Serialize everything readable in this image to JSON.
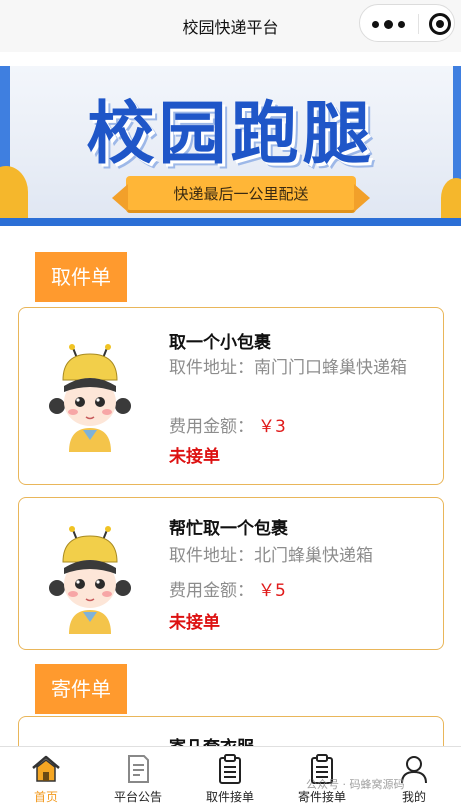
{
  "navbar": {
    "title": "校园快递平台",
    "capsule_icons": [
      "more-dots-icon",
      "close-target-icon"
    ]
  },
  "banner": {
    "title": "校园跑腿",
    "subtitle": "快递最后一公里配送"
  },
  "sections": {
    "pickup_title": "取件单",
    "send_title": "寄件单"
  },
  "pickup_orders": [
    {
      "title": "取一个小包裹",
      "address_label": "取件地址：",
      "address": "南门门口蜂巢快递箱",
      "fee_label": "费用金额：",
      "fee": "￥3",
      "status": "未接单"
    },
    {
      "title": "帮忙取一个包裹",
      "address_label": "取件地址：",
      "address": "北门蜂巢快递箱",
      "fee_label": "费用金额：",
      "fee": "￥5",
      "status": "未接单"
    }
  ],
  "send_orders": [
    {
      "title": "寄几套衣服"
    }
  ],
  "tabbar": {
    "tabs": [
      {
        "label": "首页",
        "icon": "home-icon",
        "active": true
      },
      {
        "label": "平台公告",
        "icon": "notice-icon",
        "active": false
      },
      {
        "label": "取件接单",
        "icon": "clipboard-icon",
        "active": false
      },
      {
        "label": "寄件接单",
        "icon": "clipboard-icon",
        "active": false
      },
      {
        "label": "我的",
        "icon": "user-icon",
        "active": false
      }
    ],
    "active_color": "#f29a1f"
  },
  "watermark": "公众号 · 码蜂窝源码",
  "colors": {
    "accent": "#ff9a2e",
    "status_red": "#dd1111",
    "card_border": "#e9b65a"
  }
}
